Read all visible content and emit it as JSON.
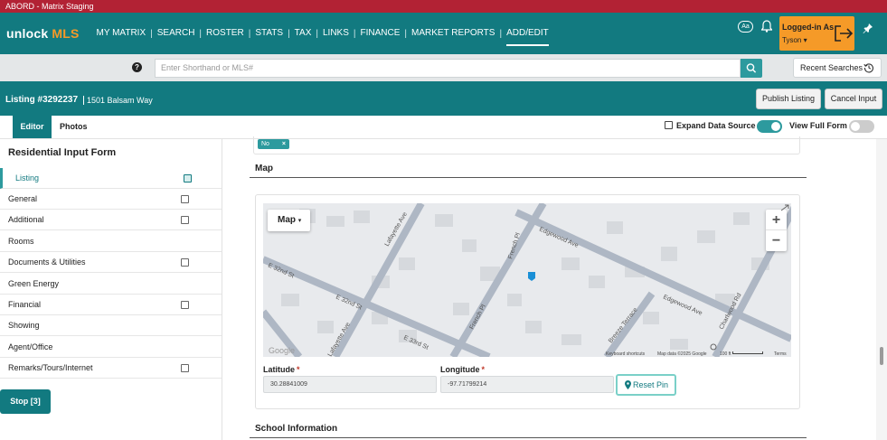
{
  "window": {
    "title": "ABORD - Matrix Staging"
  },
  "logo": {
    "brand": "unlock",
    "accent": "MLS"
  },
  "nav": {
    "items": [
      {
        "label": "MY MATRIX"
      },
      {
        "label": "SEARCH"
      },
      {
        "label": "ROSTER"
      },
      {
        "label": "STATS"
      },
      {
        "label": "TAX"
      },
      {
        "label": "LINKS"
      },
      {
        "label": "FINANCE"
      },
      {
        "label": "MARKET REPORTS"
      },
      {
        "label": "ADD/EDIT"
      }
    ],
    "active": "ADD/EDIT",
    "text_size_label": "Aa",
    "logged_in_label": "Logged-in As",
    "user_name": "Tyson"
  },
  "search": {
    "placeholder": "Enter Shorthand or MLS#",
    "recent_label": "Recent Searches"
  },
  "listing": {
    "title": "Listing #3292237",
    "address": "1501 Balsam Way",
    "publish_label": "Publish Listing",
    "cancel_label": "Cancel Input"
  },
  "tabs": {
    "editor": "Editor",
    "photos": "Photos",
    "expand_label": "Expand Data Source",
    "view_full_label": "View Full Form"
  },
  "sidebar": {
    "title": "Residential Input Form",
    "items": [
      {
        "label": "Listing"
      },
      {
        "label": "General"
      },
      {
        "label": "Additional"
      },
      {
        "label": "Rooms"
      },
      {
        "label": "Documents & Utilities"
      },
      {
        "label": "Green Energy"
      },
      {
        "label": "Financial"
      },
      {
        "label": "Showing"
      },
      {
        "label": "Agent/Office"
      },
      {
        "label": "Remarks/Tours/Internet"
      }
    ],
    "stop_label": "Stop [3]"
  },
  "form": {
    "chip_value": "No",
    "chip_remove": "×",
    "map_section_title": "Map",
    "school_section_title": "School Information"
  },
  "map": {
    "type_label": "Map",
    "zoom_in": "+",
    "zoom_out": "−",
    "google_label": "Google",
    "keyboard_shortcuts": "Keyboard shortcuts",
    "map_data": "Map data ©2025 Google",
    "scale": "100 ft",
    "terms": "Terms",
    "streets": [
      "Lafayette Ave",
      "French Pl",
      "Edgewood Ave",
      "E 32nd St",
      "E 32nd St",
      "Lafayette Ave",
      "E 33rd St",
      "French Pl",
      "Breeze Terrace",
      "Edgewood Ave",
      "Charlwood Rd"
    ]
  },
  "coords": {
    "latitude_label": "Latitude",
    "latitude_value": "30.28841009",
    "longitude_label": "Longitude",
    "longitude_value": "-97.71799214",
    "required_mark": "*",
    "reset_label": "Reset Pin"
  },
  "colors": {
    "teal": "#127a80",
    "accent_teal": "#2d9a9e",
    "orange": "#f59a28",
    "titlebar_red": "#b22234"
  }
}
